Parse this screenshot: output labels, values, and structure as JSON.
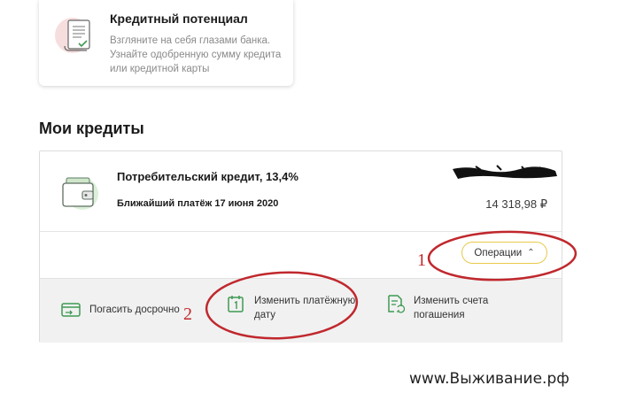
{
  "potential": {
    "title": "Кредитный потенциал",
    "description": "Взгляните на себя глазами банка. Узнайте одобренную сумму кредита или кредитной карты",
    "icon": "document-checklist-icon"
  },
  "section_title": "Мои кредиты",
  "credit": {
    "name": "Потребительский кредит, 13,4%",
    "next_payment": "Ближайший платёж 17 июня 2020",
    "amount": "14 318,98 ₽",
    "icon": "wallet-cards-icon",
    "operations_label": "Операции"
  },
  "actions": [
    {
      "label": "Погасить досрочно",
      "icon": "card-arrow-icon"
    },
    {
      "label": "Изменить платёжную дату",
      "icon": "calendar-one-icon"
    },
    {
      "label": "Изменить счета погашения",
      "icon": "document-refresh-icon"
    }
  ],
  "annotations": {
    "one": "1",
    "two": "2"
  },
  "watermark": "www.Выживание.рф",
  "colors": {
    "accent_yellow": "#e9c94a",
    "icon_green": "#3e9a52",
    "annotation_red": "#c0282d"
  }
}
